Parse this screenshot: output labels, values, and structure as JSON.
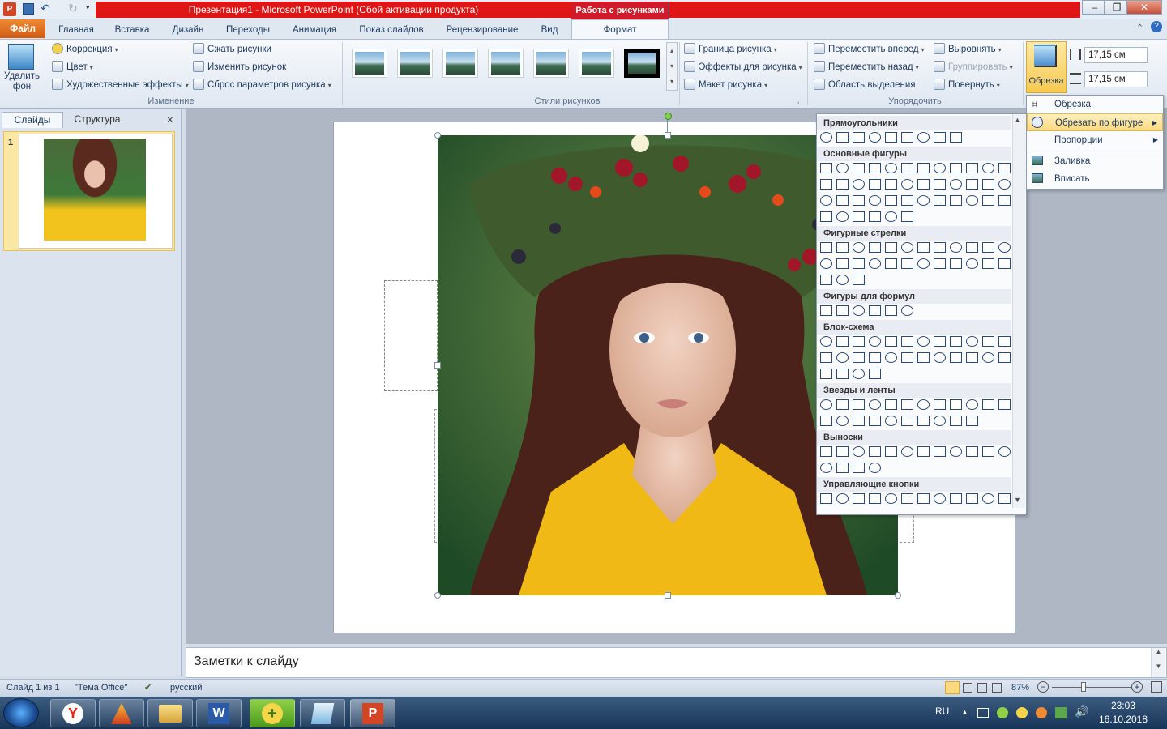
{
  "window": {
    "title": "Презентация1  -  Microsoft PowerPoint (Сбой активации продукта)",
    "context_tab_group": "Работа с рисунками"
  },
  "tabs": [
    "Файл",
    "Главная",
    "Вставка",
    "Дизайн",
    "Переходы",
    "Анимация",
    "Показ слайдов",
    "Рецензирование",
    "Вид",
    "Формат"
  ],
  "ribbon": {
    "remove_bg": "Удалить фон",
    "adjust": {
      "correction": "Коррекция",
      "color": "Цвет",
      "effects": "Художественные эффекты",
      "compress": "Сжать рисунки",
      "change": "Изменить рисунок",
      "reset": "Сброс параметров рисунка",
      "label": "Изменение"
    },
    "styles_label": "Стили рисунков",
    "picture": {
      "border": "Граница рисунка",
      "effects": "Эффекты для рисунка",
      "layout": "Макет рисунка"
    },
    "arrange": {
      "forward": "Переместить вперед",
      "backward": "Переместить назад",
      "selection": "Область выделения",
      "align": "Выровнять",
      "group": "Группировать",
      "rotate": "Повернуть",
      "label": "Упорядочить"
    },
    "crop": "Обрезка",
    "height": "17,15 см",
    "width": "17,15 см"
  },
  "crop_menu": {
    "crop": "Обрезка",
    "crop_to_shape": "Обрезать по фигуре",
    "aspect": "Пропорции",
    "fill": "Заливка",
    "fit": "Вписать"
  },
  "shapes_gallery": {
    "sections": [
      "Прямоугольники",
      "Основные фигуры",
      "Фигурные стрелки",
      "Фигуры для формул",
      "Блок-схема",
      "Звезды и ленты",
      "Выноски",
      "Управляющие кнопки"
    ]
  },
  "left_panel": {
    "tab_slides": "Слайды",
    "tab_outline": "Структура",
    "slide_number": "1"
  },
  "notes": {
    "placeholder": "Заметки к слайду"
  },
  "status": {
    "slide": "Слайд 1 из 1",
    "theme": "\"Тема Office\"",
    "language": "русский",
    "zoom": "87%"
  },
  "taskbar": {
    "lang": "RU",
    "time": "23:03",
    "date": "16.10.2018"
  },
  "colors": {
    "accent": "#e01515",
    "ribbon_bg": "#dfe7f1",
    "selected": "#fbd97e"
  }
}
